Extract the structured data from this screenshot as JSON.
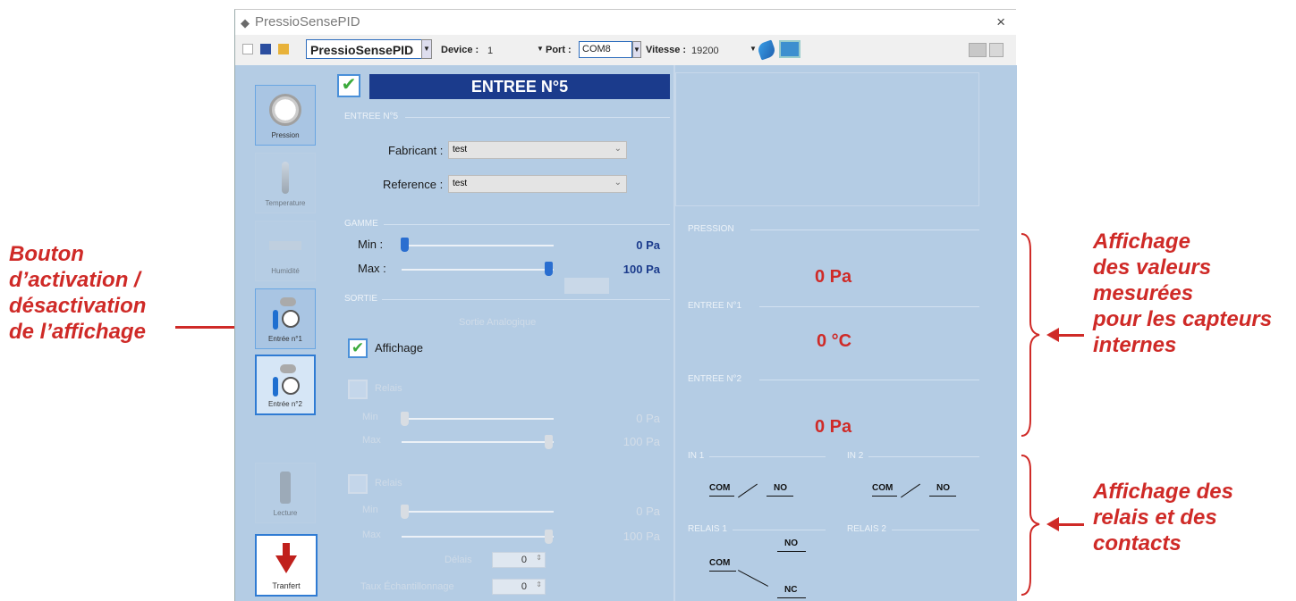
{
  "window": {
    "title": "PressioSensePID",
    "close_glyph": "×"
  },
  "toolbar": {
    "profile": "PressioSensePID",
    "device_label": "Device :",
    "device_value": "1",
    "port_label": "Port :",
    "port_value": "COM8",
    "speed_label": "Vitesse :",
    "speed_value": "19200"
  },
  "nav": {
    "items": [
      {
        "label": "Pression",
        "icon": "pressure-gauge-icon"
      },
      {
        "label": "Temperature",
        "icon": "thermometer-icon"
      },
      {
        "label": "Humidité",
        "icon": "humidity-icon"
      },
      {
        "label": "Entrée n°1",
        "icon": "thermo-gauge-icon"
      },
      {
        "label": "Entrée n°2",
        "icon": "thermo-gauge-icon"
      },
      {
        "label": "Lecture",
        "icon": "reading-icon"
      }
    ],
    "transfer_label": "Tranfert"
  },
  "entry": {
    "header": "ENTREE N°5",
    "group_title": "ENTREE N°5",
    "fabricant_label": "Fabricant :",
    "fabricant_value": "test",
    "reference_label": "Reference :",
    "reference_value": "test"
  },
  "gamme": {
    "group_title": "GAMME",
    "min_label": "Min :",
    "min_value": "0 Pa",
    "max_label": "Max :",
    "max_value": "100 Pa"
  },
  "sortie": {
    "group_title": "SORTIE",
    "faint_label": "Sortie Analogique",
    "affichage_label": "Affichage",
    "relais1_label": "Relais",
    "relais1_min_label": "Min",
    "relais1_min_value": "0 Pa",
    "relais1_max_label": "Max",
    "relais1_max_value": "100 Pa",
    "relais2_label": "Relais",
    "relais2_min_label": "Min",
    "relais2_min_value": "0 Pa",
    "relais2_max_label": "Max",
    "relais2_max_value": "100 Pa",
    "spin1_label": "Délais",
    "spin1_value": "0",
    "spin2_label": "Taux Échantillonnage",
    "spin2_value": "0"
  },
  "measurements": {
    "pression_title": "PRESSION",
    "pression_value": "0 Pa",
    "entree1_title": "ENTREE N°1",
    "entree1_value": "0 °C",
    "entree2_title": "ENTREE N°2",
    "entree2_value": "0 Pa"
  },
  "relays": {
    "in1_title": "IN 1",
    "in2_title": "IN 2",
    "relais1_title": "RELAIS 1",
    "relais2_title": "RELAIS 2",
    "com": "COM",
    "no": "NO",
    "nc": "NC"
  },
  "annotations": {
    "left": [
      "Bouton",
      "d’activation /",
      "désactivation",
      "de l’affichage"
    ],
    "right_top": [
      "Affichage",
      "des valeurs",
      "mesurées",
      "pour les capteurs",
      "internes"
    ],
    "right_bottom": [
      "Affichage des",
      "relais et des",
      "contacts"
    ]
  },
  "colors": {
    "annotation": "#cf2a27",
    "panel_bg": "#b4cce4",
    "header_bg": "#1b3b8c",
    "value_red": "#cf2a27"
  }
}
